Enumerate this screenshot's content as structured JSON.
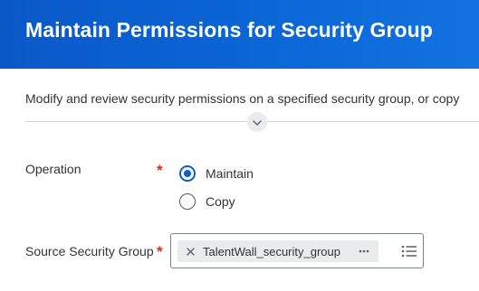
{
  "header": {
    "title": "Maintain Permissions for Security Group"
  },
  "description": "Modify and review security permissions on a specified security group, or copy",
  "icons": {
    "expand": "chevron-down-icon",
    "remove": "close-icon",
    "more": "more-horizontal-icon",
    "list": "prompt-list-icon"
  },
  "form": {
    "operation": {
      "label": "Operation",
      "required_marker": "*",
      "options": [
        {
          "label": "Maintain",
          "selected": true
        },
        {
          "label": "Copy",
          "selected": false
        }
      ]
    },
    "source_security_group": {
      "label": "Source Security Group",
      "required_marker": "*",
      "value": "TalentWall_security_group"
    }
  },
  "colors": {
    "header_bg": "#0b66d6",
    "accent": "#0a5dcc",
    "required": "#de2e21"
  }
}
